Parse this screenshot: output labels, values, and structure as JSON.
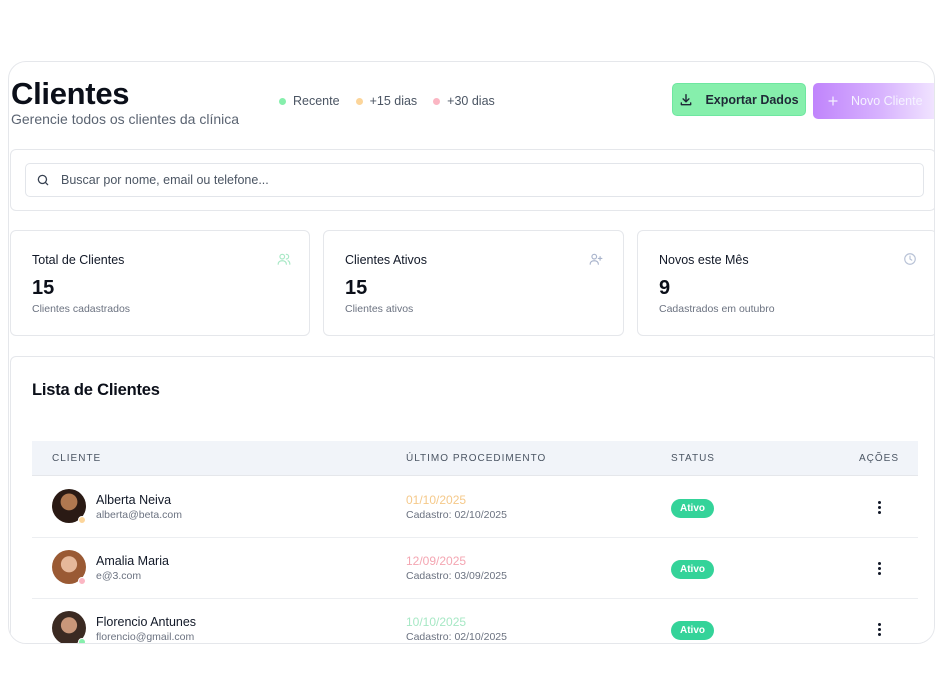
{
  "header": {
    "title": "Clientes",
    "subtitle": "Gerencie todos os clientes da clínica",
    "legend": [
      {
        "label": "Recente",
        "color": "#86efac"
      },
      {
        "label": "+15 dias",
        "color": "#fcd59a"
      },
      {
        "label": "+30 dias",
        "color": "#fbb6c3"
      }
    ],
    "export_label": "Exportar Dados",
    "new_client_label": "Novo Cliente"
  },
  "search": {
    "placeholder": "Buscar por nome, email ou telefone...",
    "value": ""
  },
  "stats": [
    {
      "title": "Total de Clientes",
      "value": "15",
      "caption": "Clientes cadastrados",
      "icon": "users-icon",
      "icon_color": "#a7e8c5"
    },
    {
      "title": "Clientes Ativos",
      "value": "15",
      "caption": "Clientes ativos",
      "icon": "user-plus-icon",
      "icon_color": "#a9b4cc"
    },
    {
      "title": "Novos este Mês",
      "value": "9",
      "caption": "Cadastrados em outubro",
      "icon": "clock-icon",
      "icon_color": "#b8c2d6"
    }
  ],
  "list": {
    "title": "Lista de Clientes",
    "columns": [
      "CLIENTE",
      "ÚLTIMO PROCEDIMENTO",
      "STATUS",
      "AÇÕES"
    ],
    "rows": [
      {
        "name": "Alberta Neiva",
        "email": "alberta@beta.com",
        "last_procedure": "01/10/2025",
        "registered": "Cadastro: 02/10/2025",
        "status": "Ativo",
        "date_color": "#f5c98a",
        "dot_color": "#fcd59a"
      },
      {
        "name": "Amalia Maria",
        "email": "e@3.com",
        "last_procedure": "12/09/2025",
        "registered": "Cadastro: 03/09/2025",
        "status": "Ativo",
        "date_color": "#f4a6b2",
        "dot_color": "#fbb6c3"
      },
      {
        "name": "Florencio Antunes",
        "email": "florencio@gmail.com",
        "last_procedure": "10/10/2025",
        "registered": "Cadastro: 02/10/2025",
        "status": "Ativo",
        "date_color": "#a7e8c5",
        "dot_color": "#86efac"
      }
    ]
  },
  "colors": {
    "accent_green": "#86efac",
    "accent_purple": "#c084fc",
    "status_active": "#34d399"
  }
}
